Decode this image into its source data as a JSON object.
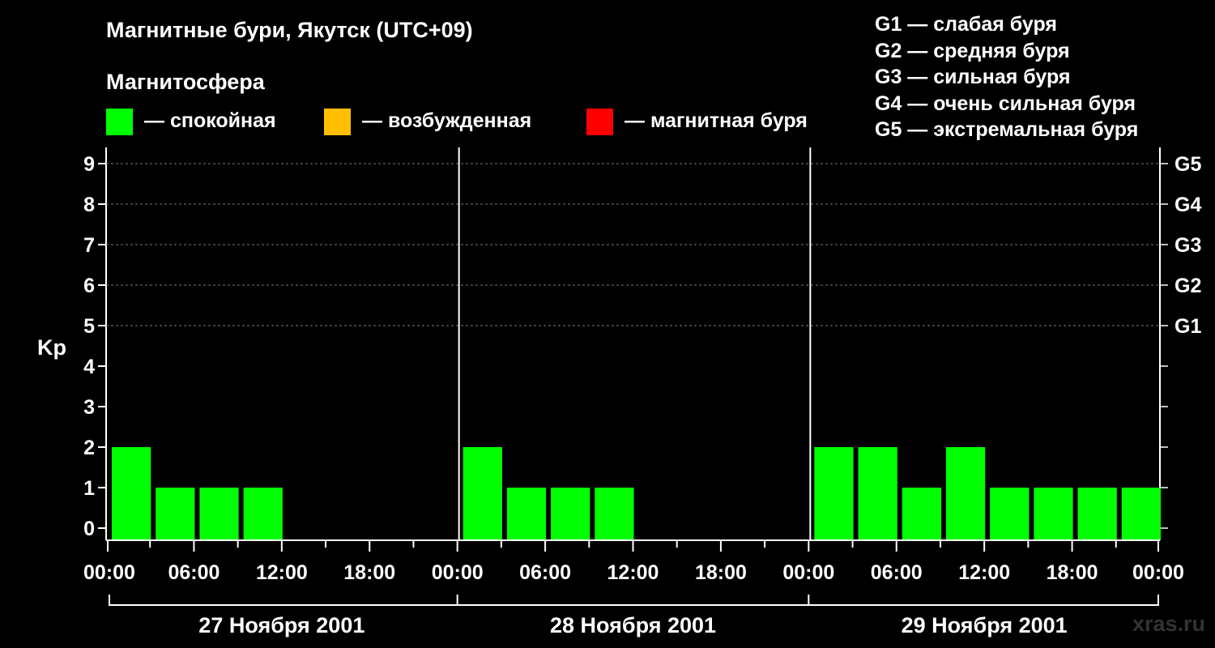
{
  "title": "Магнитные бури, Якутск (UTC+09)",
  "legend": {
    "heading": "Магнитосфера",
    "items": [
      {
        "label": "— спокойная",
        "color": "#00ff00"
      },
      {
        "label": "— возбужденная",
        "color": "#ffbf00"
      },
      {
        "label": "— магнитная буря",
        "color": "#ff0000"
      }
    ]
  },
  "g_scale": [
    "G1 — слабая буря",
    "G2 — средняя буря",
    "G3 — сильная буря",
    "G4 — очень сильная буря",
    "G5 — экстремальная буря"
  ],
  "watermark": "xras.ru",
  "chart_data": {
    "type": "bar",
    "ylabel": "Kp",
    "ylim": [
      0,
      9
    ],
    "yticks": [
      0,
      1,
      2,
      3,
      4,
      5,
      6,
      7,
      8,
      9
    ],
    "right_ticks": [
      {
        "value": 5,
        "label": "G1"
      },
      {
        "value": 6,
        "label": "G2"
      },
      {
        "value": 7,
        "label": "G3"
      },
      {
        "value": 8,
        "label": "G4"
      },
      {
        "value": 9,
        "label": "G5"
      }
    ],
    "grid": "dashed at Kp 5-9",
    "xtick_labels": [
      "00:00",
      "06:00",
      "12:00",
      "18:00",
      "00:00",
      "06:00",
      "12:00",
      "18:00",
      "00:00",
      "06:00",
      "12:00",
      "18:00",
      "00:00"
    ],
    "days": [
      {
        "label": "27 Ноября 2001",
        "values": [
          2,
          1,
          1,
          1,
          null,
          null,
          null,
          null
        ]
      },
      {
        "label": "28 Ноября 2001",
        "values": [
          2,
          1,
          1,
          1,
          null,
          null,
          null,
          null
        ]
      },
      {
        "label": "29 Ноября 2001",
        "values": [
          2,
          2,
          1,
          2,
          1,
          1,
          1,
          1
        ]
      }
    ],
    "interval_hours": 3,
    "bar_color": "#00ff00"
  }
}
